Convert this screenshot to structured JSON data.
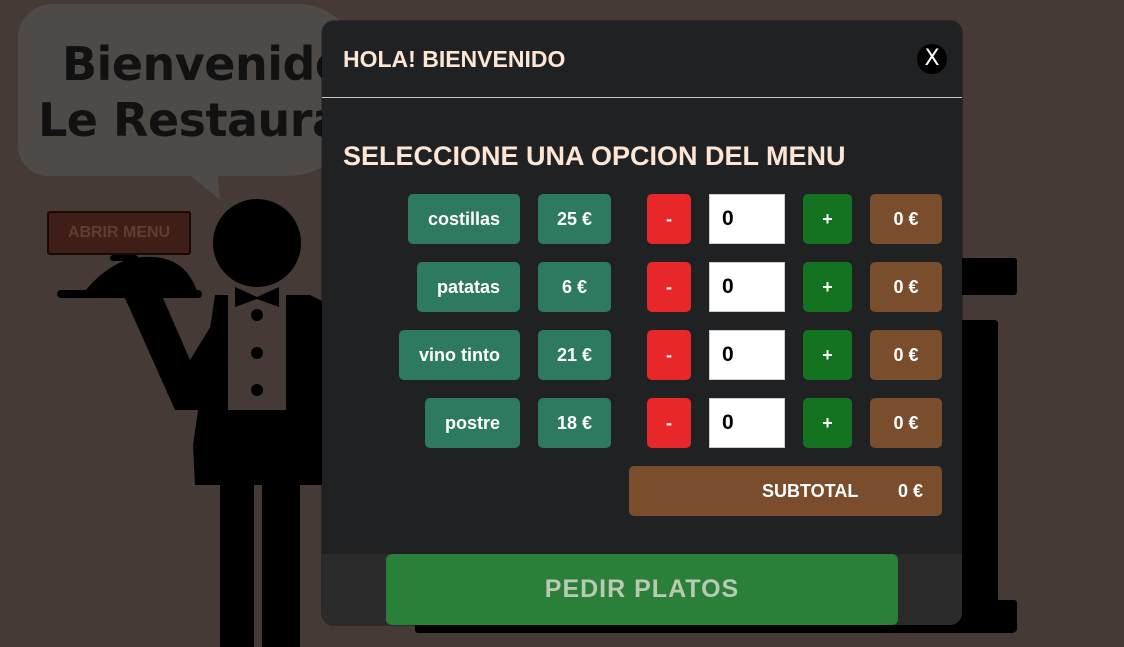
{
  "background": {
    "welcome_line1": "Bienvenido a",
    "welcome_line2": "Le Restaurant",
    "open_menu_label": "ABRIR MENU"
  },
  "modal": {
    "title": "HOLA! BIENVENIDO",
    "close_label": "X",
    "section_title": "SELECCIONE UNA OPCION DEL MENU",
    "items": [
      {
        "name": "costillas",
        "price": "25 €",
        "minus": "-",
        "qty": "0",
        "plus": "+",
        "total": "0 €"
      },
      {
        "name": "patatas",
        "price": "6 €",
        "minus": "-",
        "qty": "0",
        "plus": "+",
        "total": "0 €"
      },
      {
        "name": "vino tinto",
        "price": "21 €",
        "minus": "-",
        "qty": "0",
        "plus": "+",
        "total": "0 €"
      },
      {
        "name": "postre",
        "price": "18 €",
        "minus": "-",
        "qty": "0",
        "plus": "+",
        "total": "0 €"
      }
    ],
    "subtotal_label": "SUBTOTAL",
    "subtotal_value": "0 €",
    "order_button": "PEDIR PLATOS"
  },
  "colors": {
    "page_bg": "#453a36",
    "modal_bg": "#202123",
    "item_green": "#2e7a60",
    "minus_red": "#e8272b",
    "plus_green": "#137320",
    "total_brown": "#7a4d2c",
    "order_green": "#2a8038"
  }
}
